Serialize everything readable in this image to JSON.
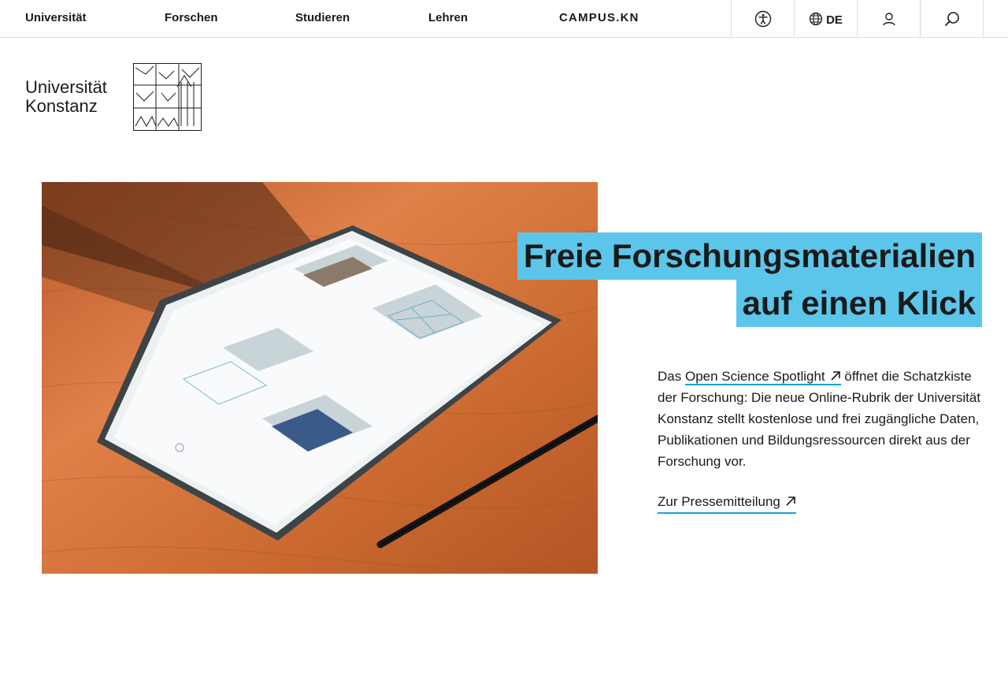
{
  "nav": {
    "items": [
      "Universität",
      "Forschen",
      "Studieren",
      "Lehren"
    ],
    "campus": "CAMPUS.KN",
    "language": "DE",
    "icons": [
      "accessibility-icon",
      "globe-icon",
      "user-icon",
      "search-icon"
    ]
  },
  "logo": {
    "line1": "Universität",
    "line2": "Konstanz"
  },
  "hero": {
    "headline_line1": "Freie Forschungsmaterialien",
    "headline_line2": "auf einen Klick",
    "text_before": "Das ",
    "link_label": "Open Science Spotlight",
    "text_after": " öffnet die Schatzkiste der Forschung: Die neue Online-Rubrik der Universität Konstanz stellt kostenlose und frei zugängliche Daten, Publikationen und Bildungsressourcen direkt aus der Forschung vor.",
    "press_link": "Zur Pressemitteilung"
  },
  "colors": {
    "accent": "#5bc6ea",
    "link_underline": "#1aa3d8",
    "text": "#1a1a1a"
  }
}
